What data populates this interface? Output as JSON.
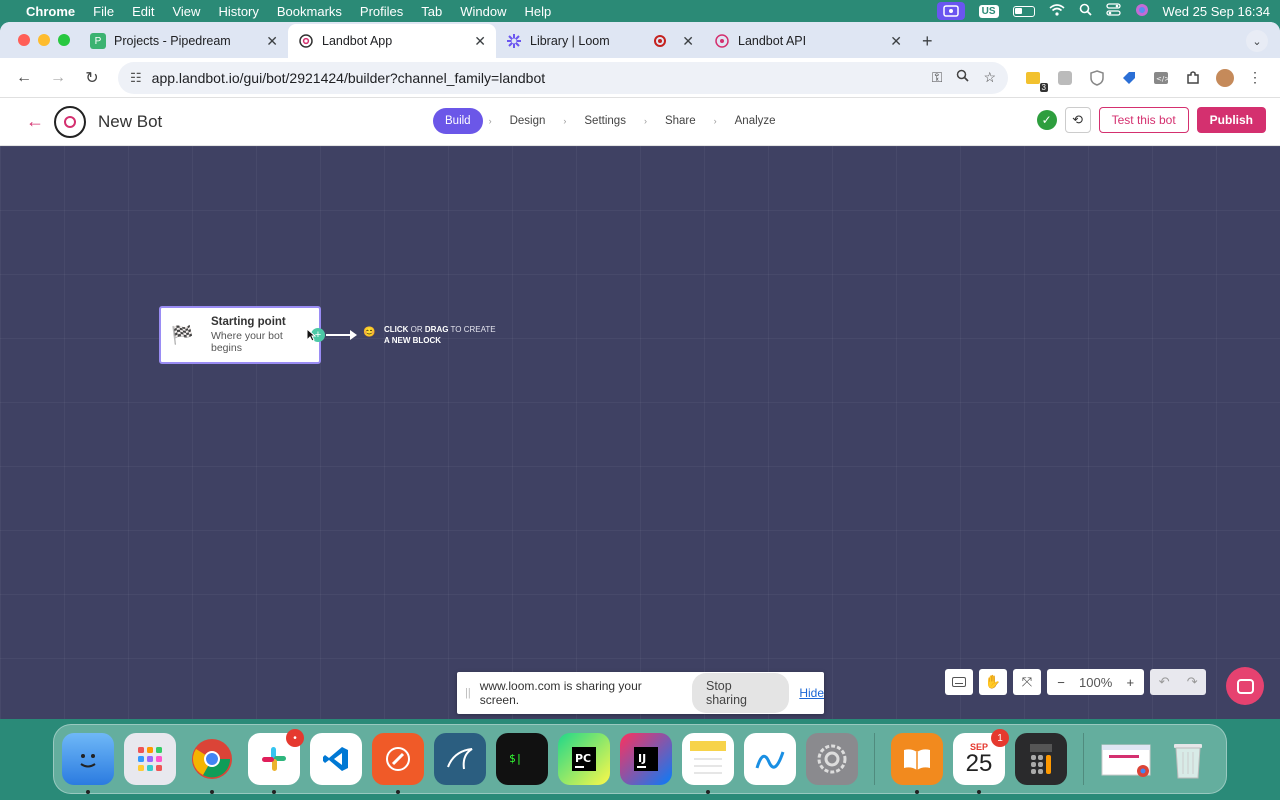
{
  "menubar": {
    "app_name": "Chrome",
    "items": [
      "File",
      "Edit",
      "View",
      "History",
      "Bookmarks",
      "Profiles",
      "Tab",
      "Window",
      "Help"
    ],
    "input_source": "US",
    "datetime": "Wed 25 Sep  16:34"
  },
  "browser": {
    "tabs": [
      {
        "title": "Projects - Pipedream",
        "favicon": "pipedream-icon",
        "color": "#3cb371",
        "letter": "P"
      },
      {
        "title": "Landbot App",
        "favicon": "landbot-icon",
        "color": "#d4306f"
      },
      {
        "title": "Library | Loom",
        "favicon": "loom-icon",
        "color": "#6a55f0"
      },
      {
        "title": "Landbot API",
        "favicon": "landbot-icon",
        "color": "#d4306f"
      }
    ],
    "url": "app.landbot.io/gui/bot/2921424/builder?channel_family=landbot",
    "extension_badge": "3"
  },
  "app": {
    "bot_name": "New Bot",
    "steps": [
      "Build",
      "Design",
      "Settings",
      "Share",
      "Analyze"
    ],
    "test_label": "Test this bot",
    "publish_label": "Publish",
    "accent": "#d4306f",
    "step_active_color": "#6b57e8"
  },
  "canvas": {
    "start_title": "Starting point",
    "start_subtitle": "Where your bot begins",
    "hint_click": "CLICK",
    "hint_or": " OR ",
    "hint_drag": "DRAG",
    "hint_to_create": " TO CREATE",
    "hint_new_block": "A NEW BLOCK",
    "zoom_level": "100%"
  },
  "loom": {
    "message": "www.loom.com is sharing your screen.",
    "stop_label": "Stop sharing",
    "hide_label": "Hide"
  },
  "dock": {
    "slack_badge": "•",
    "calendar_month": "SEP",
    "calendar_day": "25",
    "calendar_badge": "1"
  }
}
